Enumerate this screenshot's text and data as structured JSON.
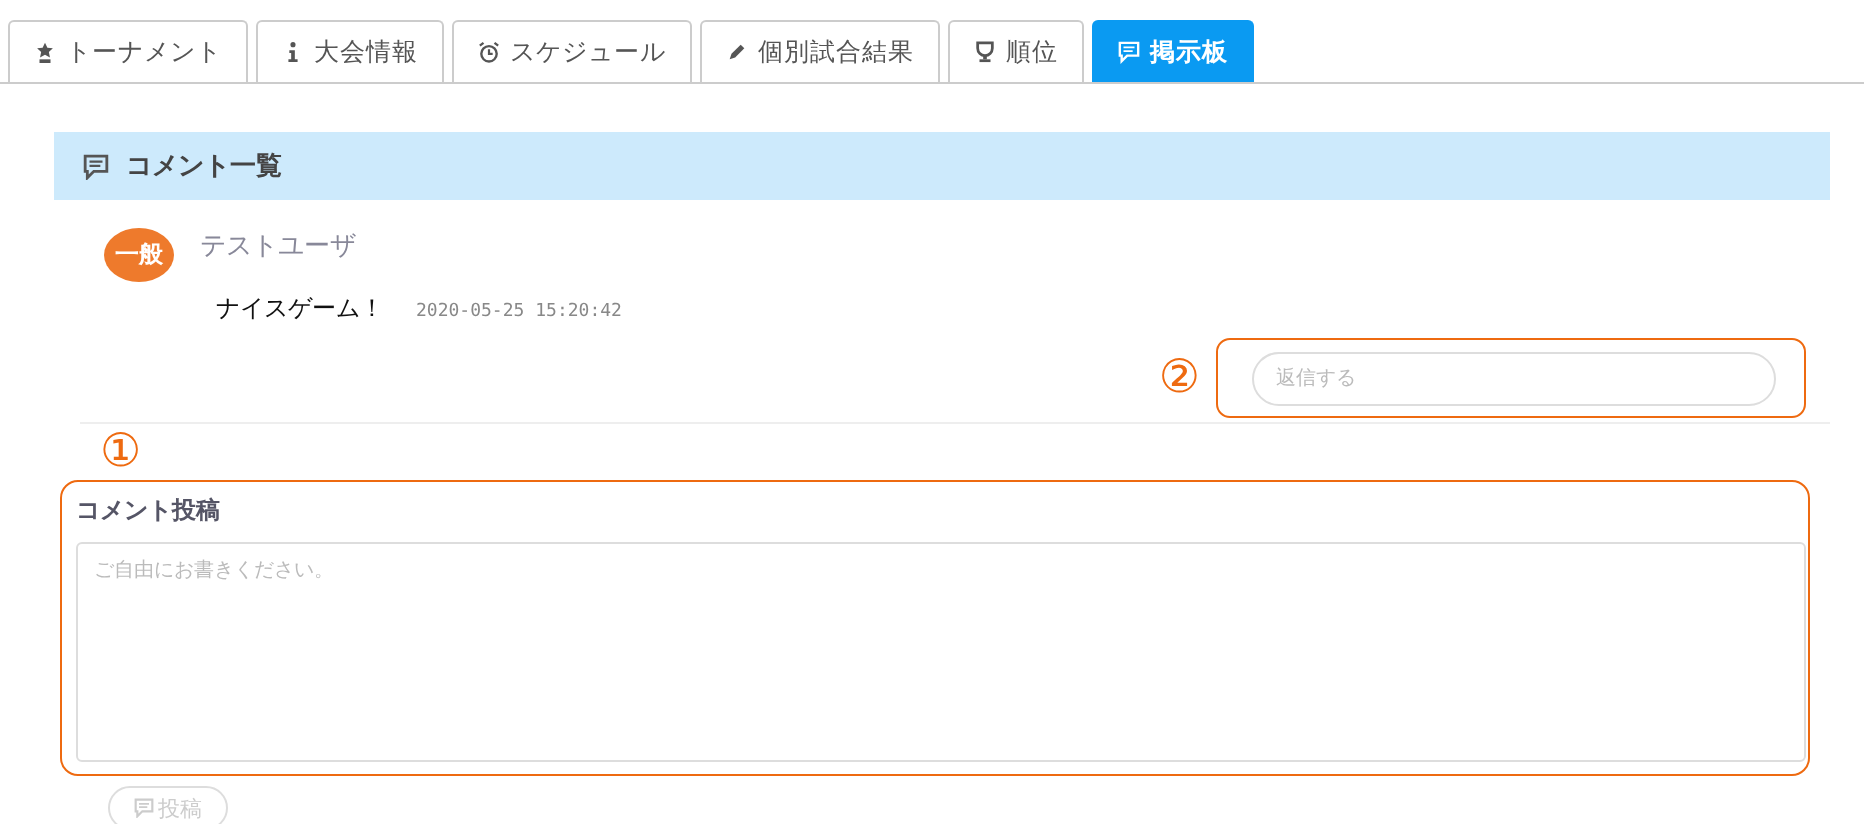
{
  "tabs": [
    {
      "label": "トーナメント",
      "selected": false
    },
    {
      "label": "大会情報",
      "selected": false
    },
    {
      "label": "スケジュール",
      "selected": false
    },
    {
      "label": "個別試合結果",
      "selected": false
    },
    {
      "label": "順位",
      "selected": false
    },
    {
      "label": "掲示板",
      "selected": true
    }
  ],
  "comment_list": {
    "title": "コメント一覧",
    "comments": [
      {
        "badge": "一般",
        "user": "テストユーザ",
        "text": "ナイスゲーム！",
        "time": "2020-05-25 15:20:42"
      }
    ],
    "reply": {
      "marker": "②",
      "placeholder": "返信する"
    }
  },
  "post": {
    "marker": "①",
    "label": "コメント投稿",
    "placeholder": "ご自由にお書きください。",
    "button": "投稿",
    "button_disabled": true
  }
}
